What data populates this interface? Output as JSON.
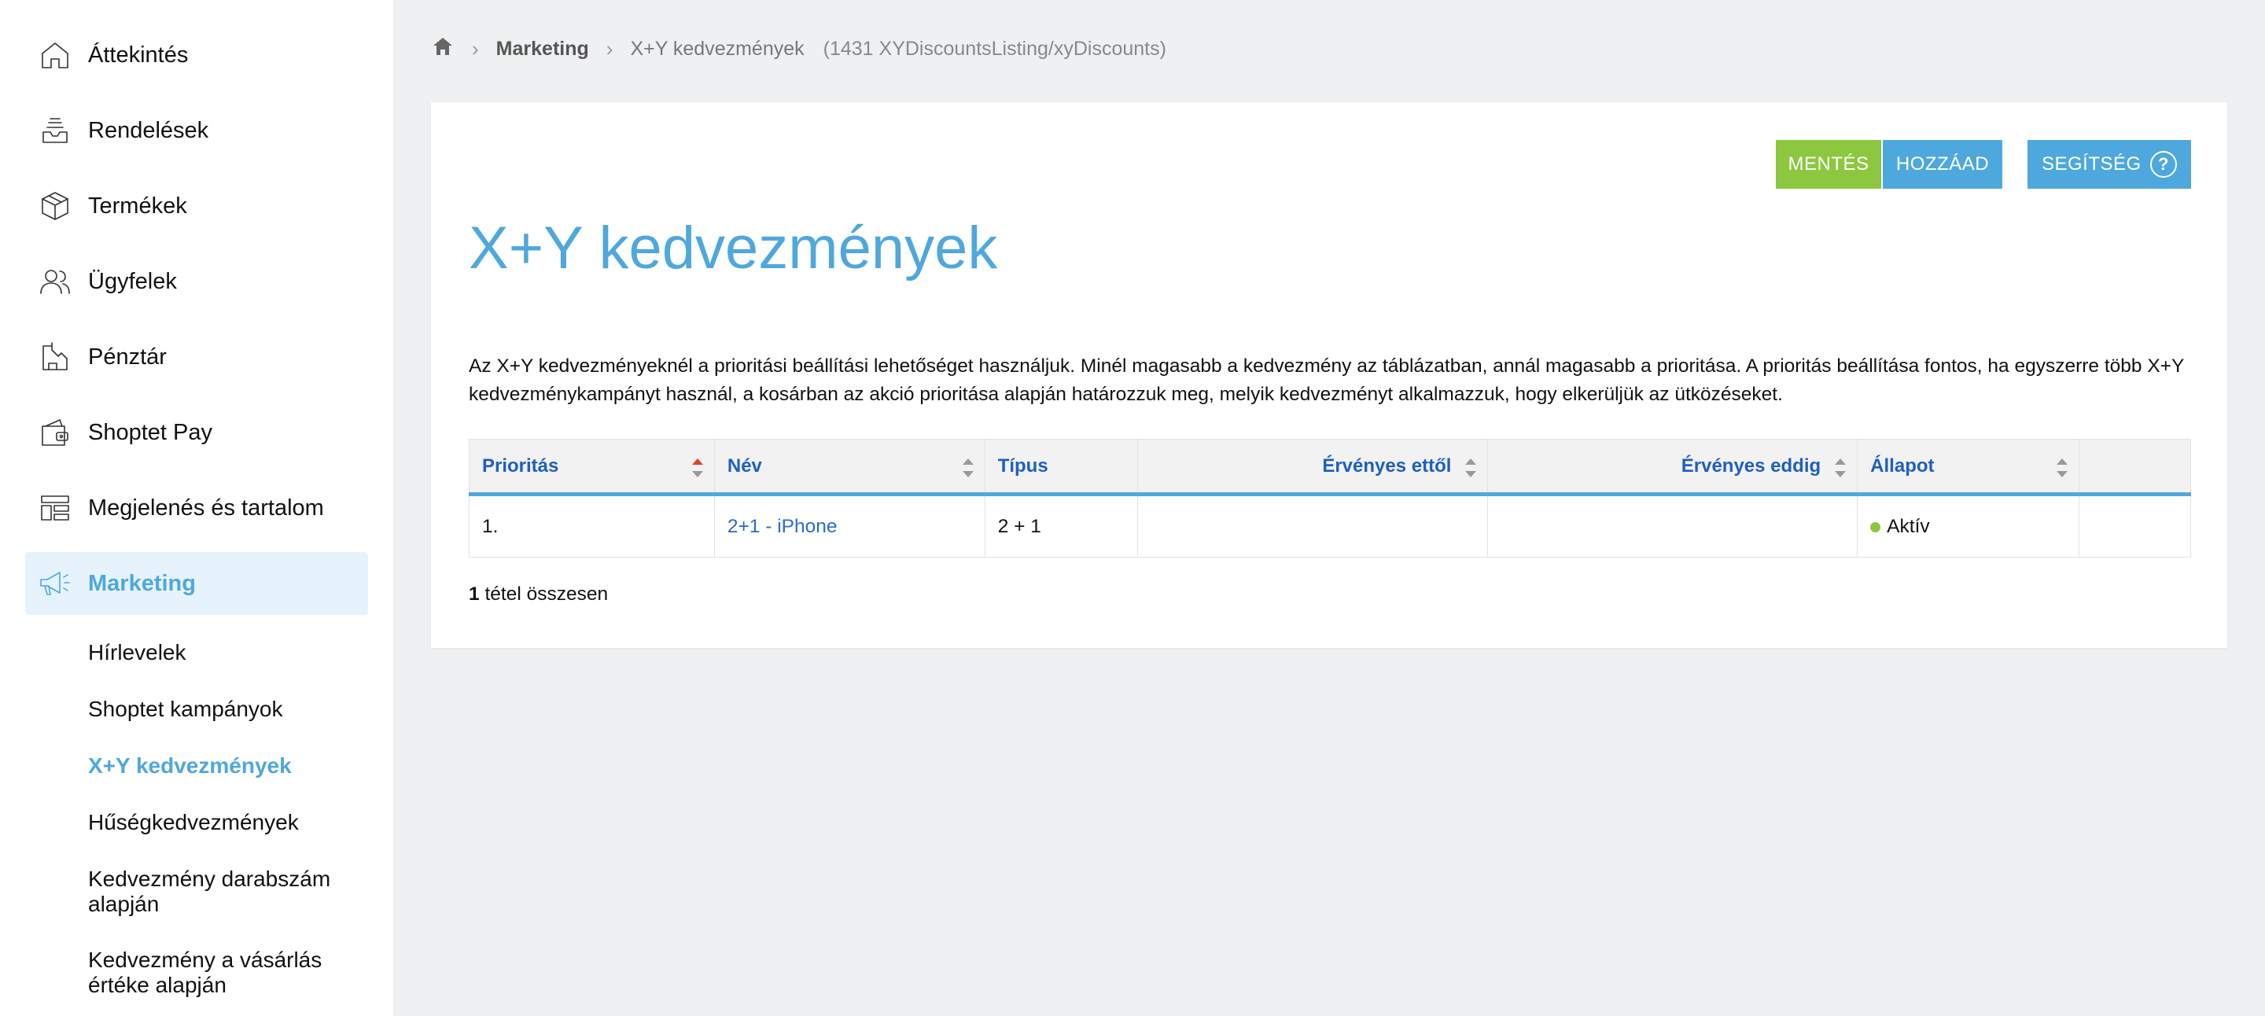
{
  "sidebar": {
    "items": [
      {
        "label": "Áttekintés",
        "icon": "home-icon"
      },
      {
        "label": "Rendelések",
        "icon": "inbox-icon"
      },
      {
        "label": "Termékek",
        "icon": "box-icon"
      },
      {
        "label": "Ügyfelek",
        "icon": "users-icon"
      },
      {
        "label": "Pénztár",
        "icon": "cash-register-icon"
      },
      {
        "label": "Shoptet Pay",
        "icon": "wallet-icon"
      },
      {
        "label": "Megjelenés és tartalom",
        "icon": "layout-icon"
      },
      {
        "label": "Marketing",
        "icon": "megaphone-icon",
        "active": true
      }
    ],
    "subitems": [
      {
        "label": "Hírlevelek"
      },
      {
        "label": "Shoptet kampányok"
      },
      {
        "label": "X+Y kedvezmények",
        "active": true
      },
      {
        "label": "Hűségkedvezmények"
      },
      {
        "label": "Kedvezmény darabszám alapján"
      },
      {
        "label": "Kedvezmény a vásárlás értéke alapján"
      }
    ]
  },
  "breadcrumb": {
    "section": "Marketing",
    "current": "X+Y kedvezmények",
    "code": "(1431 XYDiscountsListing/xyDiscounts)"
  },
  "toolbar": {
    "save_label": "MENTÉS",
    "add_label": "HOZZÁAD",
    "help_label": "SEGÍTSÉG",
    "help_glyph": "?"
  },
  "main": {
    "title": "X+Y kedvezmények",
    "description": "Az X+Y kedvezményeknél a prioritási beállítási lehetőséget használjuk. Minél magasabb a kedvezmény az táblázatban, annál magasabb a prioritása. A prioritás beállítása fontos, ha egyszerre több X+Y kedvezménykampányt használ, a kosárban az akció prioritása alapján határozzuk meg, melyik kedvezményt alkalmazzuk, hogy elkerüljük az ütközéseket."
  },
  "table": {
    "headers": [
      "Prioritás",
      "Név",
      "Típus",
      "Érvényes ettől",
      "Érvényes eddig",
      "Állapot",
      ""
    ],
    "rows": [
      {
        "priority": "1.",
        "name": "2+1 - iPhone",
        "type": "2 + 1",
        "valid_from": "",
        "valid_to": "",
        "status": "Aktív"
      }
    ],
    "total_count": "1",
    "total_label": " tétel összesen"
  },
  "colors": {
    "accent": "#4ea8de",
    "success": "#8dc63f",
    "link": "#2b6bc7",
    "sort_active": "#e0452c"
  }
}
